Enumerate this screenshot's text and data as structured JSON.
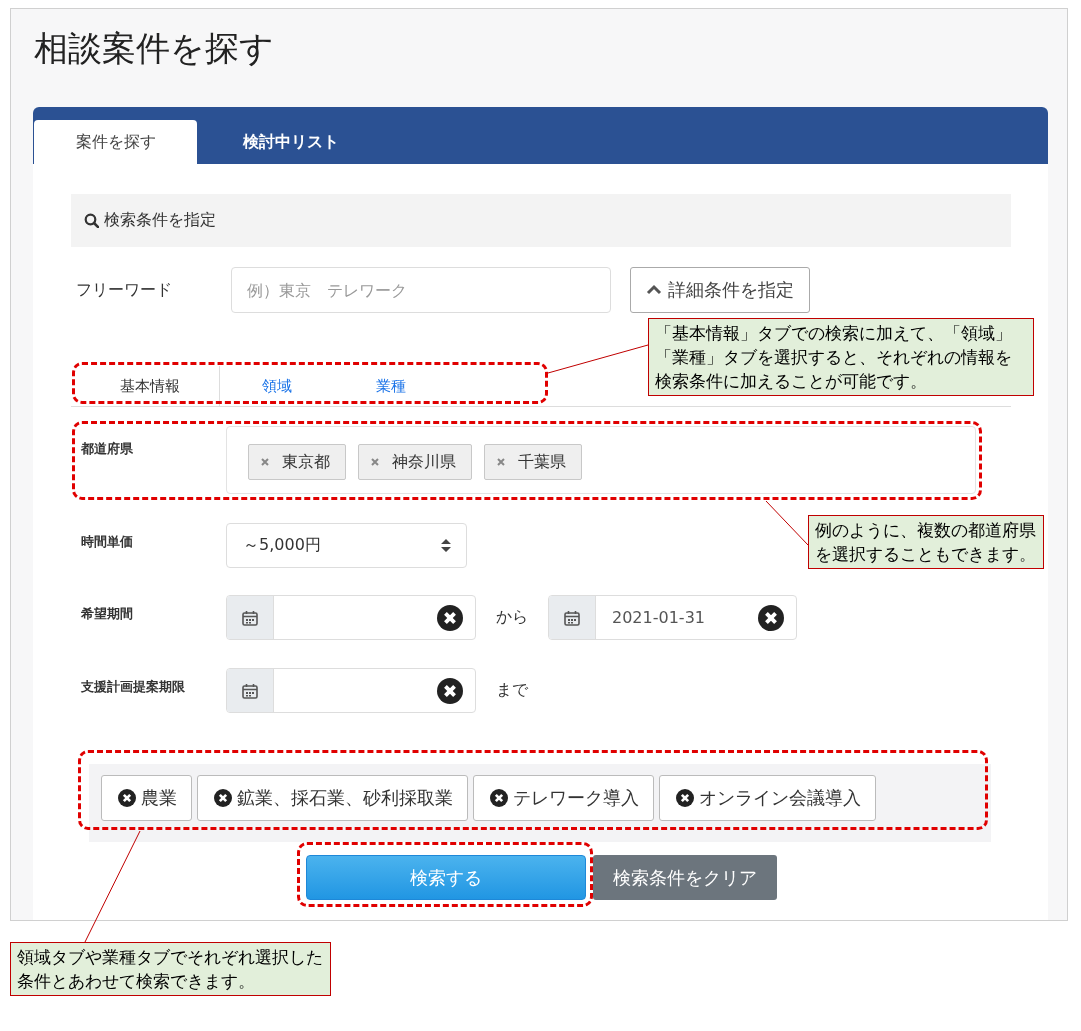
{
  "page_title": "相談案件を探す",
  "tabs": [
    {
      "label": "案件を探す",
      "selected": true
    },
    {
      "label": "検討中リスト",
      "selected": false
    }
  ],
  "search_header": "検索条件を指定",
  "freeword": {
    "label": "フリーワード",
    "placeholder": "例）東京　テレワーク"
  },
  "detail_button": "詳細条件を指定",
  "sub_tabs": [
    {
      "label": "基本情報",
      "selected": true
    },
    {
      "label": "領域",
      "selected": false
    },
    {
      "label": "業種",
      "selected": false
    }
  ],
  "prefecture": {
    "label": "都道府県",
    "chips": [
      "東京都",
      "神奈川県",
      "千葉県"
    ]
  },
  "hourly_rate": {
    "label": "時間単価",
    "value": "～5,000円"
  },
  "period": {
    "label": "希望期間",
    "separator": "から",
    "to_value": "2021-01-31"
  },
  "deadline": {
    "label": "支援計画提案期限",
    "suffix": "まで"
  },
  "selected_conditions": [
    "農業",
    "鉱業、採石業、砂利採取業",
    "テレワーク導入",
    "オンライン会議導入"
  ],
  "buttons": {
    "search": "検索する",
    "clear": "検索条件をクリア"
  },
  "annotations": [
    {
      "text": "「基本情報」タブでの検索に加えて、「領域」「業種」タブを選択すると、それぞれの情報を検索条件に加えることが可能です。"
    },
    {
      "text": "例のように、複数の都道府県を選択することもできます。"
    },
    {
      "text": "領域タブや業種タブでそれぞれ選択した条件とあわせて検索できます。"
    }
  ]
}
